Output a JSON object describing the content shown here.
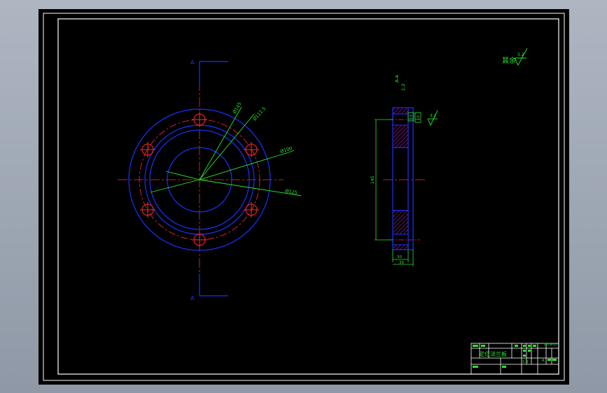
{
  "annotations": {
    "section_mark_top": "A",
    "section_mark_bottom": "A",
    "dim_d1": "Ø145",
    "dim_d2": "Ø112.5",
    "dim_d3": "Ø100",
    "dim_d4": "Ø125",
    "side_label_1": "A-A",
    "side_label_2": "1:2",
    "dim_hole_1": "13",
    "dim_hole_2": "10",
    "dim_height": "145",
    "dim_width_inner": "30",
    "dim_width_outer": "30",
    "roughness_main": "3.2",
    "roughness_rest_label": "其余",
    "roughness_rest": "3.2"
  },
  "title_block": {
    "part_name": "定位法兰板",
    "scale": "1:2",
    "code": "DFLB-05",
    "sheet_mark": "A"
  },
  "colors": {
    "frame": "#ffffff",
    "outline": "#1a33ff",
    "centerline": "#ff2b2b",
    "dimension": "#29e629",
    "hatch": "#d11ad1",
    "text": "#ffffff"
  }
}
